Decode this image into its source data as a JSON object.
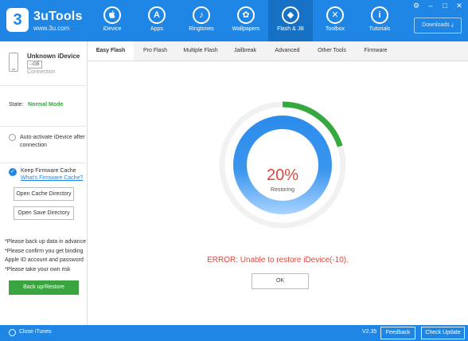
{
  "app": {
    "name": "3uTools",
    "url": "www.3u.com",
    "logo_glyph": "3"
  },
  "window_controls": [
    "⚙",
    "–",
    "□",
    "✕"
  ],
  "nav": {
    "active": "Flash & JB",
    "items": [
      {
        "label": "iDevice",
        "icon": "apple-icon",
        "glyph": ""
      },
      {
        "label": "Apps",
        "icon": "apps-icon",
        "glyph": "A"
      },
      {
        "label": "Ringtones",
        "icon": "bell-icon",
        "glyph": "♪"
      },
      {
        "label": "Wallpapers",
        "icon": "flower-icon",
        "glyph": "✿"
      },
      {
        "label": "Flash & JB",
        "icon": "dropbox-icon",
        "glyph": "◆"
      },
      {
        "label": "Toolbox",
        "icon": "tools-icon",
        "glyph": "✕"
      },
      {
        "label": "Tutorials",
        "icon": "info-icon",
        "glyph": "i"
      }
    ],
    "downloads_label": "Downloads",
    "downloads_icon": "⤓"
  },
  "sidebar": {
    "device_name": "Unknown iDevice",
    "capacity": "--GB",
    "connection": "Connection",
    "state_label": "State:",
    "state_value": "Normal Mode",
    "auto_activate": "Auto-activate iDevice after connection",
    "keep_cache": "Keep Firmware Cache",
    "whats_cache": "What's Firmware Cache?",
    "open_cache_dir": "Open Cache Directory",
    "open_save_dir": "Open Save Directory",
    "notes": [
      "*Please back up data in advance",
      "*Please confirm you get binding",
      "Apple ID account and password",
      "*Please take your own risk"
    ],
    "backup_button": "Back up/Restore"
  },
  "subtabs": {
    "active": "Easy Flash",
    "items": [
      "Easy Flash",
      "Pro Flash",
      "Multiple Flash",
      "Jailbreak",
      "Advanced",
      "Other Tools",
      "Firmware"
    ]
  },
  "progress": {
    "percent_text": "20%",
    "value": 0.2,
    "status": "Restoring",
    "colors": {
      "progress": "#35a93f",
      "track": "#f1f1f1",
      "inner_dark": "#2c8cec",
      "inner_light": "#a9d3ff"
    }
  },
  "error_message": "ERROR: Unable to restore iDevice(-10).",
  "ok_button": "OK",
  "bottom": {
    "close_itunes": "Close iTunes",
    "version": "V2.35",
    "feedback": "Feedback",
    "check_update": "Check Update"
  },
  "theme": {
    "brand_blue": "#1f86e6",
    "active_nav": "#1670c4",
    "green": "#3aa441",
    "error_red": "#e0463c"
  }
}
